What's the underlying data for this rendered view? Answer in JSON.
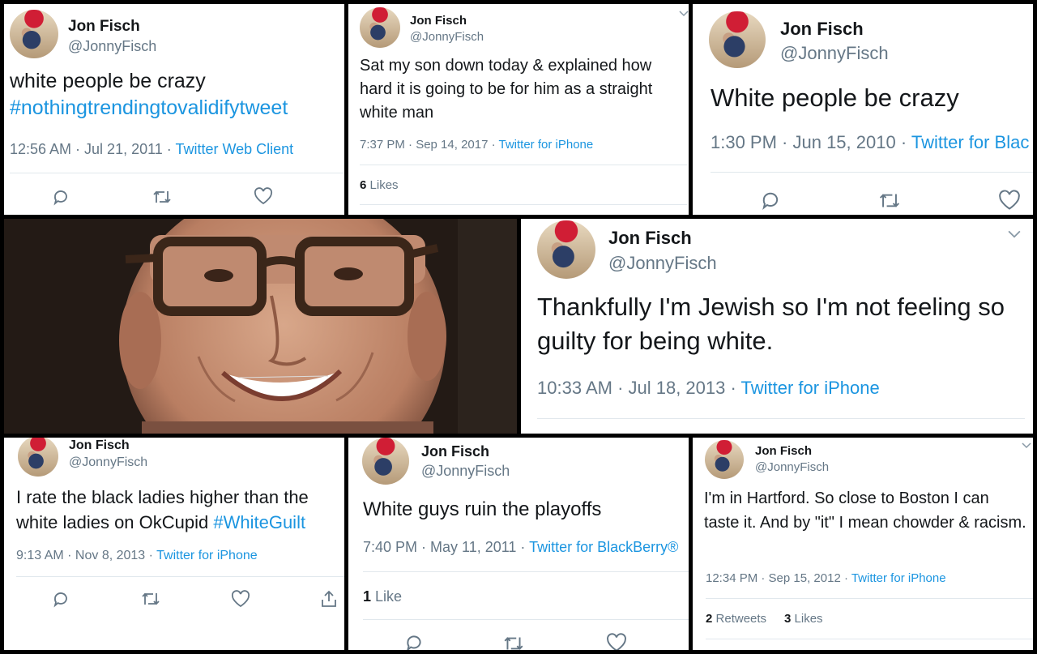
{
  "tweets": [
    {
      "name": "Jon Fisch",
      "handle": "@JonnyFisch",
      "text": "white people be crazy",
      "tag": "#nothingtrendingtovalidifytweet",
      "time": "12:56 AM · Jul 21, 2011 · ",
      "source": "Twitter Web Client"
    },
    {
      "name": "Jon Fisch",
      "handle": "@JonnyFisch",
      "text": "Sat my son down today & explained how hard it is going to be for him as a straight white man",
      "time": "7:37 PM · Sep 14, 2017 · ",
      "source": "Twitter for iPhone",
      "likes_count": "6",
      "likes_label": "Likes"
    },
    {
      "name": "Jon Fisch",
      "handle": "@JonnyFisch",
      "text": "White people be crazy",
      "time": "1:30 PM · Jun 15, 2010 · ",
      "source": "Twitter for Blac"
    },
    {
      "name": "Jon Fisch",
      "handle": "@JonnyFisch",
      "text": "Thankfully I'm Jewish so I'm not feeling so guilty for being white.",
      "time": "10:33 AM · Jul 18, 2013 · ",
      "source": "Twitter for iPhone"
    },
    {
      "name": "Jon Fisch",
      "handle": "@JonnyFisch",
      "text": "I rate the black ladies higher than the white ladies on OkCupid ",
      "tag": "#WhiteGuilt",
      "time": "9:13 AM · Nov 8, 2013 · ",
      "source": "Twitter for iPhone"
    },
    {
      "name": "Jon Fisch",
      "handle": "@JonnyFisch",
      "text": "White guys ruin the playoffs",
      "time": "7:40 PM · May 11, 2011 · ",
      "source": "Twitter for BlackBerry®",
      "likes_count": "1",
      "likes_label": "Like"
    },
    {
      "name": "Jon Fisch",
      "handle": "@JonnyFisch",
      "text": "I'm in Hartford. So close to Boston I can taste it. And by \"it\" I mean chowder & racism.",
      "time": "12:34 PM · Sep 15, 2012 · ",
      "source": "Twitter for iPhone",
      "retweets_count": "2",
      "retweets_label": "Retweets",
      "likes_count": "3",
      "likes_label": "Likes"
    }
  ],
  "colors": {
    "link": "#1b95e0",
    "muted": "#657786",
    "text": "#14171a",
    "border": "#e1e8ed"
  },
  "icons": [
    "reply-icon",
    "retweet-icon",
    "like-icon",
    "share-icon",
    "chevron-down-icon"
  ]
}
